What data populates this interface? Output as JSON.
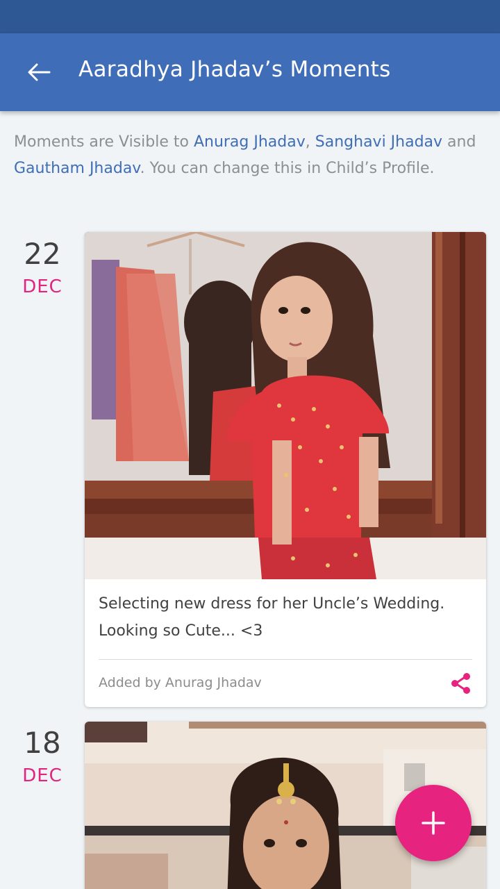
{
  "header": {
    "title": "Aaradhya Jhadav’s Moments",
    "back_icon": "arrow-left-icon"
  },
  "notice": {
    "prefix": "Moments are Visible to ",
    "name_1": "Anurag Jhadav",
    "sep_1": ", ",
    "name_2": "Sanghavi Jhadav",
    "sep_2": " and ",
    "name_3": "Gautham Jhadav",
    "suffix": ". You can change this in Child’s Profile."
  },
  "moments": [
    {
      "day": "22",
      "month": "DEC",
      "caption": "Selecting new dress for her Uncle’s Wedding. Looking so Cute... <3",
      "added_by": "Added by Anurag Jhadav",
      "share_icon": "share-icon"
    },
    {
      "day": "18",
      "month": "DEC"
    }
  ],
  "fab": {
    "icon": "plus-icon"
  },
  "colors": {
    "status_bar": "#2e5893",
    "app_bar": "#3f6db7",
    "accent": "#e6237f",
    "link": "#3f6db7"
  }
}
